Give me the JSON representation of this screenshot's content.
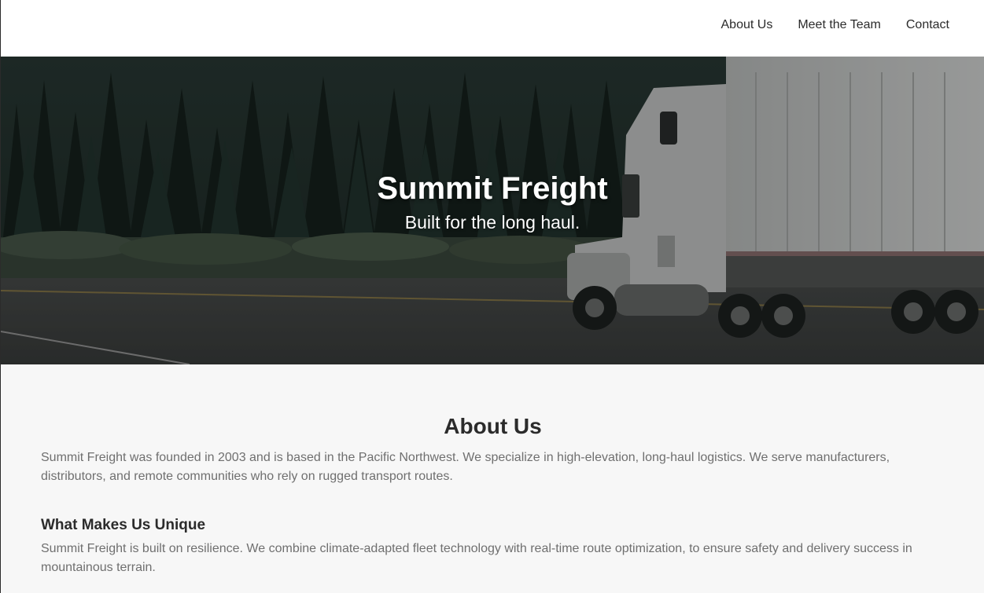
{
  "nav": {
    "items": [
      {
        "label": "About Us"
      },
      {
        "label": "Meet the Team"
      },
      {
        "label": "Contact"
      }
    ]
  },
  "hero": {
    "title": "Summit Freight",
    "subtitle": "Built for the long haul."
  },
  "about": {
    "title": "About Us",
    "body": "Summit Freight was founded in 2003 and is based in the Pacific Northwest. We specialize in high-elevation, long-haul logistics. We serve manufacturers, distributors, and remote communities who rely on rugged transport routes.",
    "unique_title": "What Makes Us Unique",
    "unique_body": "Summit Freight is built on resilience. We combine climate-adapted fleet technology with real-time route optimization, to ensure safety and delivery success in mountainous terrain."
  }
}
